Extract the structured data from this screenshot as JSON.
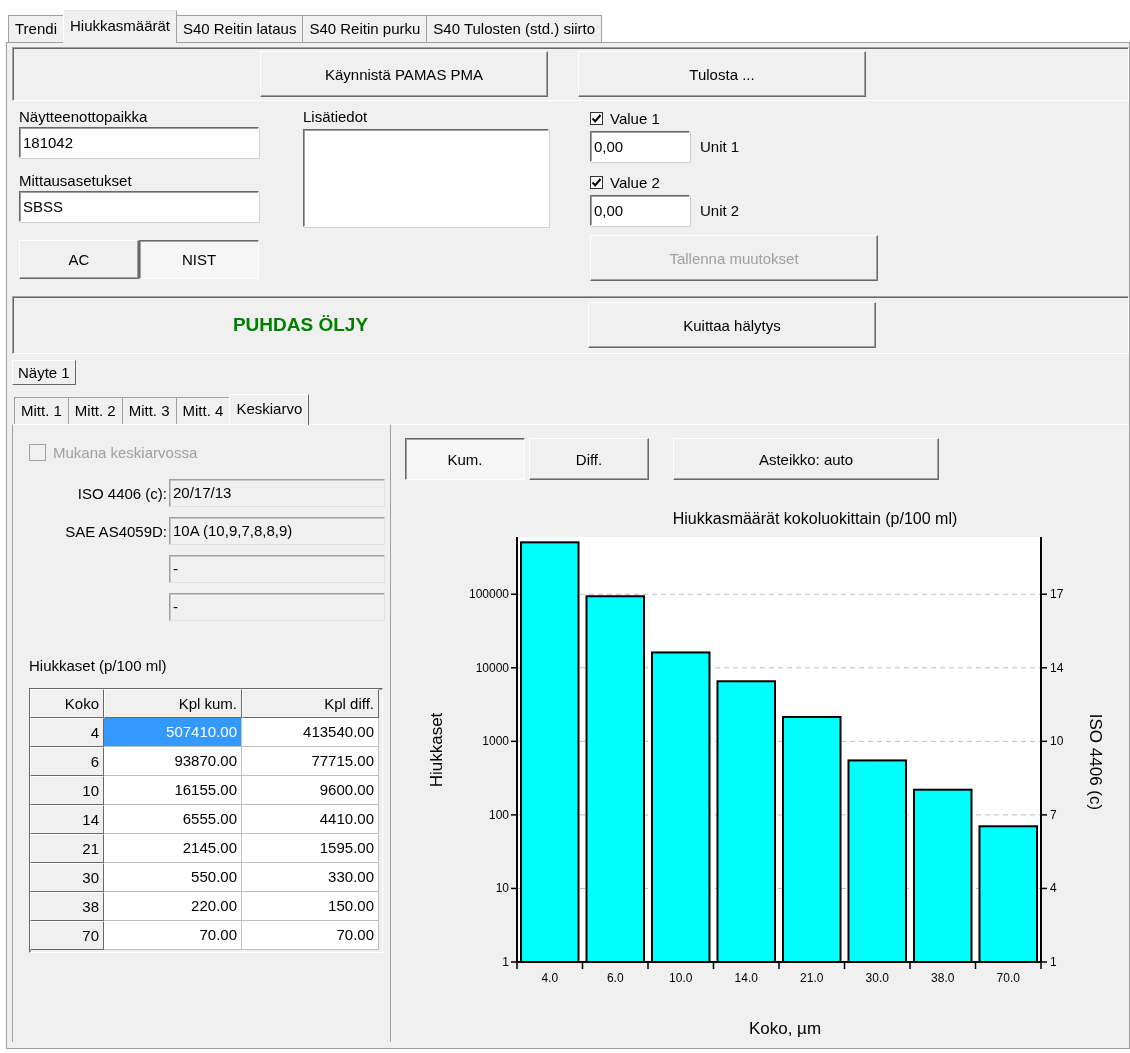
{
  "tabs": [
    {
      "label": "Trendi",
      "selected": false
    },
    {
      "label": "Hiukkasmäärät",
      "selected": true
    },
    {
      "label": "S40 Reitin lataus",
      "selected": false
    },
    {
      "label": "S40 Reitin purku",
      "selected": false
    },
    {
      "label": "S40 Tulosten (std.) siirto",
      "selected": false
    }
  ],
  "top_buttons": [
    "Käynnistä PAMAS PMA",
    "Tulosta ..."
  ],
  "sample_location": {
    "label": "Näytteenottopaikka",
    "value": "181042"
  },
  "measurement_settings": {
    "label": "Mittausasetukset",
    "value": "SBSS"
  },
  "notes": {
    "label": "Lisätiedot"
  },
  "standard_toggle": [
    {
      "label": "AC",
      "selected": false
    },
    {
      "label": "NIST",
      "selected": true
    }
  ],
  "values": [
    {
      "label": "Value 1",
      "checked": true,
      "value": "0,00",
      "unit": "Unit 1"
    },
    {
      "label": "Value 2",
      "checked": true,
      "value": "0,00",
      "unit": "Unit 2"
    }
  ],
  "save_button": {
    "label": "Tallenna muutokset",
    "disabled": true
  },
  "status": {
    "text": "PUHDAS ÖLJY"
  },
  "acknowledge_button": "Kuittaa hälytys",
  "sample_tabs": [
    {
      "label": "Näyte 1",
      "selected": true
    }
  ],
  "measurement_tabs": [
    {
      "label": "Mitt. 1",
      "selected": false
    },
    {
      "label": "Mitt. 2",
      "selected": false
    },
    {
      "label": "Mitt. 3",
      "selected": false
    },
    {
      "label": "Mitt. 4",
      "selected": false
    },
    {
      "label": "Keskiarvo",
      "selected": true
    }
  ],
  "include_in_average": {
    "label": "Mukana keskiarvossa",
    "checked": false,
    "disabled": true
  },
  "classifications": [
    {
      "label": "ISO 4406 (c):",
      "value": "20/17/13"
    },
    {
      "label": "SAE AS4059D:",
      "value": "10A (10,9,7,8,8,9)"
    },
    {
      "value": "-"
    },
    {
      "value": "-"
    }
  ],
  "particles_table": {
    "title": "Hiukkaset (p/100 ml)",
    "columns": [
      "Koko",
      "Kpl kum.",
      "Kpl diff."
    ],
    "rows": [
      {
        "cells": [
          "4",
          "507410.00",
          "413540.00"
        ],
        "selected": true
      },
      {
        "cells": [
          "6",
          "93870.00",
          "77715.00"
        ],
        "selected": false
      },
      {
        "cells": [
          "10",
          "16155.00",
          "9600.00"
        ],
        "selected": false
      },
      {
        "cells": [
          "14",
          "6555.00",
          "4410.00"
        ],
        "selected": false
      },
      {
        "cells": [
          "21",
          "2145.00",
          "1595.00"
        ],
        "selected": false
      },
      {
        "cells": [
          "30",
          "550.00",
          "330.00"
        ],
        "selected": false
      },
      {
        "cells": [
          "38",
          "220.00",
          "150.00"
        ],
        "selected": false
      },
      {
        "cells": [
          "70",
          "70.00",
          "70.00"
        ],
        "selected": false
      }
    ]
  },
  "chart_buttons": [
    {
      "label": "Kum.",
      "selected": true
    },
    {
      "label": "Diff.",
      "selected": false
    }
  ],
  "scale_button": "Asteikko: auto",
  "chart": {
    "title": "Hiukkasmäärät kokoluokittain (p/100 ml)",
    "xlabel": "Koko, µm",
    "ylabel": "Hiukkaset",
    "y2label": "ISO 4406 (c)",
    "categories": [
      "4.0",
      "6.0",
      "10.0",
      "14.0",
      "21.0",
      "30.0",
      "38.0",
      "70.0"
    ],
    "left_axis_labels": [
      "100000",
      "10000",
      "1000",
      "100",
      "10",
      "1"
    ],
    "right_axis_labels": [
      "17",
      "14",
      "10",
      "7",
      "4",
      "1"
    ]
  }
}
